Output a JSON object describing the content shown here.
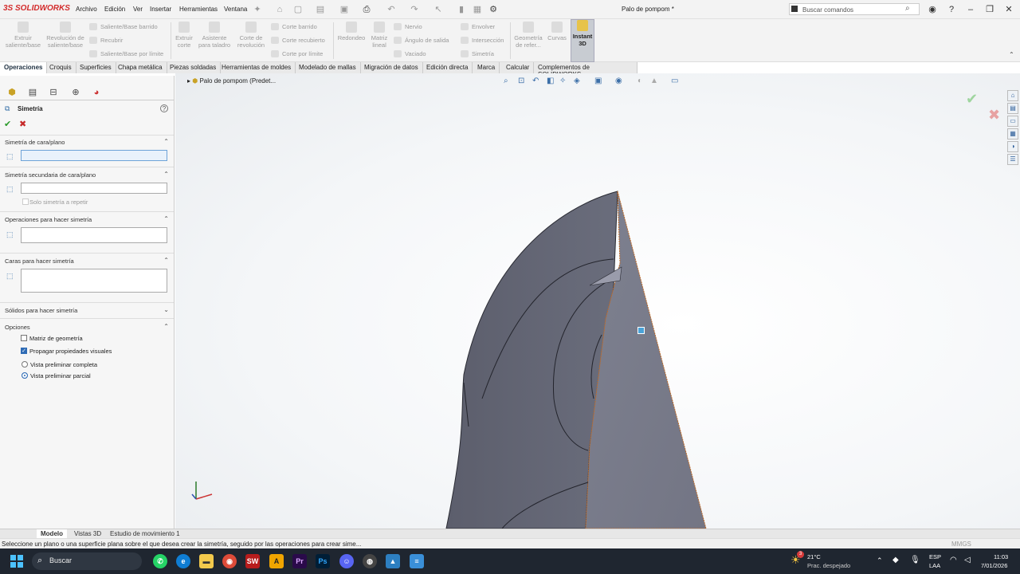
{
  "app": {
    "logo": "3S SOLIDWORKS",
    "menu": [
      "Archivo",
      "Edición",
      "Ver",
      "Insertar",
      "Herramientas",
      "Ventana"
    ],
    "doc_title": "Palo de pompom *",
    "search_placeholder": "Buscar comandos"
  },
  "ribbon": {
    "extrude": "Extruir saliente/base",
    "revolve": "Revolución de saliente/base",
    "sweep": "Saliente/Base barrido",
    "loft": "Recubrir",
    "boundary": "Saliente/Base por límite",
    "extrude_cut": "Extruir corte",
    "hole": "Asistente para taladro",
    "revolve_cut": "Corte de revolución",
    "swept_cut": "Corte barrido",
    "lofted_cut": "Corte recubierto",
    "boundary_cut": "Corte por límite",
    "fillet": "Redondeo",
    "linear": "Matriz lineal",
    "rib": "Nervio",
    "draft": "Ángulo de salida",
    "shell": "Vaciado",
    "wrap": "Envolver",
    "intersect": "Intersección",
    "mirror": "Simetría",
    "refgeom": "Geometría de refer...",
    "curves": "Curvas",
    "instant3d": "Instant 3D"
  },
  "tabs": [
    "Operaciones",
    "Croquis",
    "Superficies",
    "Chapa metálica",
    "Piezas soldadas",
    "Herramientas de moldes",
    "Modelado de mallas",
    "Migración de datos",
    "Edición directa",
    "Marca",
    "Calcular",
    "Complementos de SOLIDWORKS"
  ],
  "panel": {
    "title": "Simetría",
    "sec1": "Simetría de cara/plano",
    "sec2": "Simetría secundaria de cara/plano",
    "only_repeat": "Solo simetría a repetir",
    "sec3": "Operaciones para hacer simetría",
    "sec4": "Caras para hacer simetría",
    "sec5": "Sólidos para hacer simetría",
    "sec6": "Opciones",
    "opt1": "Matriz de geometría",
    "opt2": "Propagar propiedades visuales",
    "opt3": "Vista preliminar completa",
    "opt4": "Vista preliminar parcial"
  },
  "tree": {
    "root": "Palo de pompom (Predet..."
  },
  "bottom_tabs": [
    "Modelo",
    "Vistas 3D",
    "Estudio de movimiento 1"
  ],
  "status": {
    "text": "Seleccione un plano o una superficie plana sobre el que desea crear la simetría, seguido por las operaciones para crear sime...",
    "units": "MMGS"
  },
  "taskbar": {
    "search": "Buscar",
    "weather_temp": "21°C",
    "weather_desc": "Prac. despejado",
    "lang1": "ESP",
    "lang2": "LAA",
    "time": "11:03",
    "date": "7/01/2026",
    "badge": "3"
  }
}
